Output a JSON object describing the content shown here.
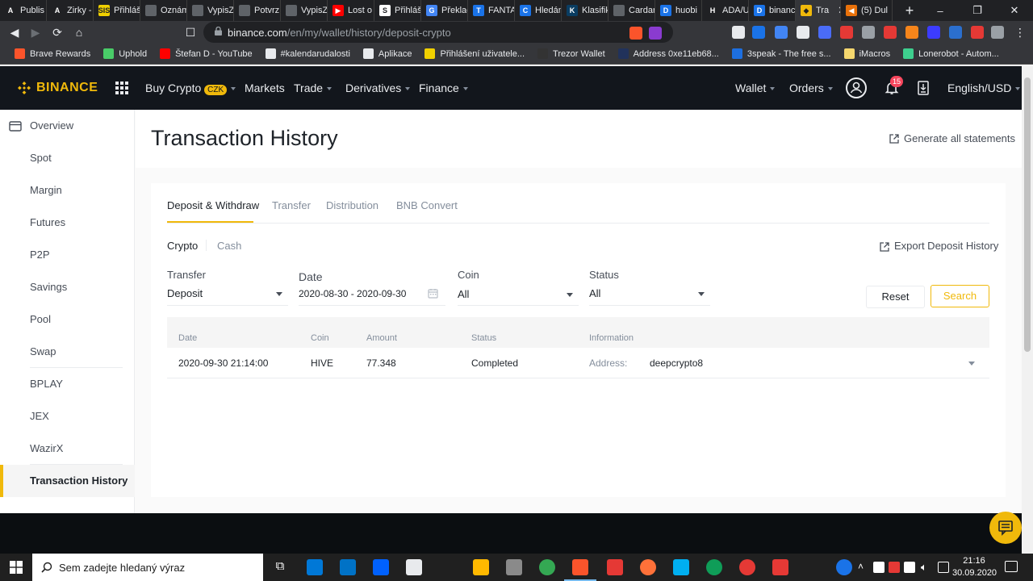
{
  "browser": {
    "tabs": [
      {
        "title": "Publis",
        "color": "#202124",
        "letter": "A"
      },
      {
        "title": "Zirky -",
        "color": "#202124",
        "letter": "A"
      },
      {
        "title": "Přihláš",
        "color": "#f0d000",
        "letter": "SIS"
      },
      {
        "title": "Oznám",
        "color": "#5f6368",
        "letter": ""
      },
      {
        "title": "VypisZ",
        "color": "#5f6368",
        "letter": ""
      },
      {
        "title": "Potvrz",
        "color": "#5f6368",
        "letter": ""
      },
      {
        "title": "VypisZ",
        "color": "#5f6368",
        "letter": ""
      },
      {
        "title": "Lost o",
        "color": "#ff0000",
        "letter": "▶"
      },
      {
        "title": "Přihláš",
        "color": "#ffffff",
        "letter": "S"
      },
      {
        "title": "Překlac",
        "color": "#4285f4",
        "letter": "G"
      },
      {
        "title": "FANTA",
        "color": "#1a73e8",
        "letter": "T"
      },
      {
        "title": "Hledán",
        "color": "#1a73e8",
        "letter": "C"
      },
      {
        "title": "Klasifik",
        "color": "#0a3d62",
        "letter": "K"
      },
      {
        "title": "Cardan",
        "color": "#5f6368",
        "letter": ""
      },
      {
        "title": "huobi",
        "color": "#1a73e8",
        "letter": "D"
      },
      {
        "title": "ADA/U",
        "color": "#202124",
        "letter": "H"
      },
      {
        "title": "binanc",
        "color": "#1a73e8",
        "letter": "D"
      },
      {
        "title": "Tra",
        "color": "#f0b90b",
        "letter": "◆",
        "active": true
      },
      {
        "title": "(5) Dul",
        "color": "#e8710a",
        "letter": "◀"
      }
    ],
    "url_host": "binance.com",
    "url_path": "/en/my/wallet/history/deposit-crypto",
    "bookmarks": [
      {
        "label": "Brave Rewards",
        "color": "#fb542b"
      },
      {
        "label": "Uphold",
        "color": "#49cc68"
      },
      {
        "label": "Štefan D - YouTube",
        "color": "#ff0000"
      },
      {
        "label": "#kalendarudalosti",
        "color": "#e8eaed"
      },
      {
        "label": "Aplikace",
        "color": "#e8eaed"
      },
      {
        "label": "Přihlášení uživatele...",
        "color": "#f0d000"
      },
      {
        "label": "Trezor Wallet",
        "color": "#333333"
      },
      {
        "label": "Address 0xe11eb68...",
        "color": "#21325b"
      },
      {
        "label": "3speak - The free s...",
        "color": "#1d6fe0"
      },
      {
        "label": "iMacros",
        "color": "#f5d76e"
      },
      {
        "label": "Lonerobot - Autom...",
        "color": "#3ecf8e"
      }
    ]
  },
  "binance": {
    "logo": "BINANCE",
    "nav": {
      "buy_crypto": "Buy Crypto",
      "currency_badge": "CZK",
      "markets": "Markets",
      "trade": "Trade",
      "derivatives": "Derivatives",
      "finance": "Finance",
      "wallet": "Wallet",
      "orders": "Orders",
      "notifications": "15",
      "language": "English/USD"
    },
    "sidebar": [
      {
        "label": "Overview"
      },
      {
        "label": "Spot"
      },
      {
        "label": "Margin"
      },
      {
        "label": "Futures"
      },
      {
        "label": "P2P"
      },
      {
        "label": "Savings"
      },
      {
        "label": "Pool"
      },
      {
        "label": "Swap"
      },
      {
        "label": "BPLAY"
      },
      {
        "label": "JEX"
      },
      {
        "label": "WazirX"
      },
      {
        "label": "Transaction History",
        "active": true
      }
    ],
    "page_title": "Transaction History",
    "generate_statements": "Generate all statements",
    "tabs": [
      "Deposit & Withdraw",
      "Transfer",
      "Distribution",
      "BNB Convert"
    ],
    "subtabs": [
      "Crypto",
      "Cash"
    ],
    "export_link": "Export Deposit History",
    "filters": {
      "transfer_label": "Transfer",
      "transfer_value": "Deposit",
      "date_label": "Date",
      "date_value": "2020-08-30 - 2020-09-30",
      "coin_label": "Coin",
      "coin_value": "All",
      "status_label": "Status",
      "status_value": "All",
      "reset": "Reset",
      "search": "Search"
    },
    "table": {
      "columns": [
        "Date",
        "Coin",
        "Amount",
        "Status",
        "Information"
      ],
      "rows": [
        {
          "date": "2020-09-30 21:14:00",
          "coin": "HIVE",
          "amount": "77.348",
          "status": "Completed",
          "info_label": "Address:",
          "info_value": "deepcrypto8"
        }
      ]
    },
    "accent": "#f0b90b"
  },
  "taskbar": {
    "search_placeholder": "Sem zadejte hledaný výraz",
    "time": "21:16",
    "date": "30.09.2020"
  }
}
